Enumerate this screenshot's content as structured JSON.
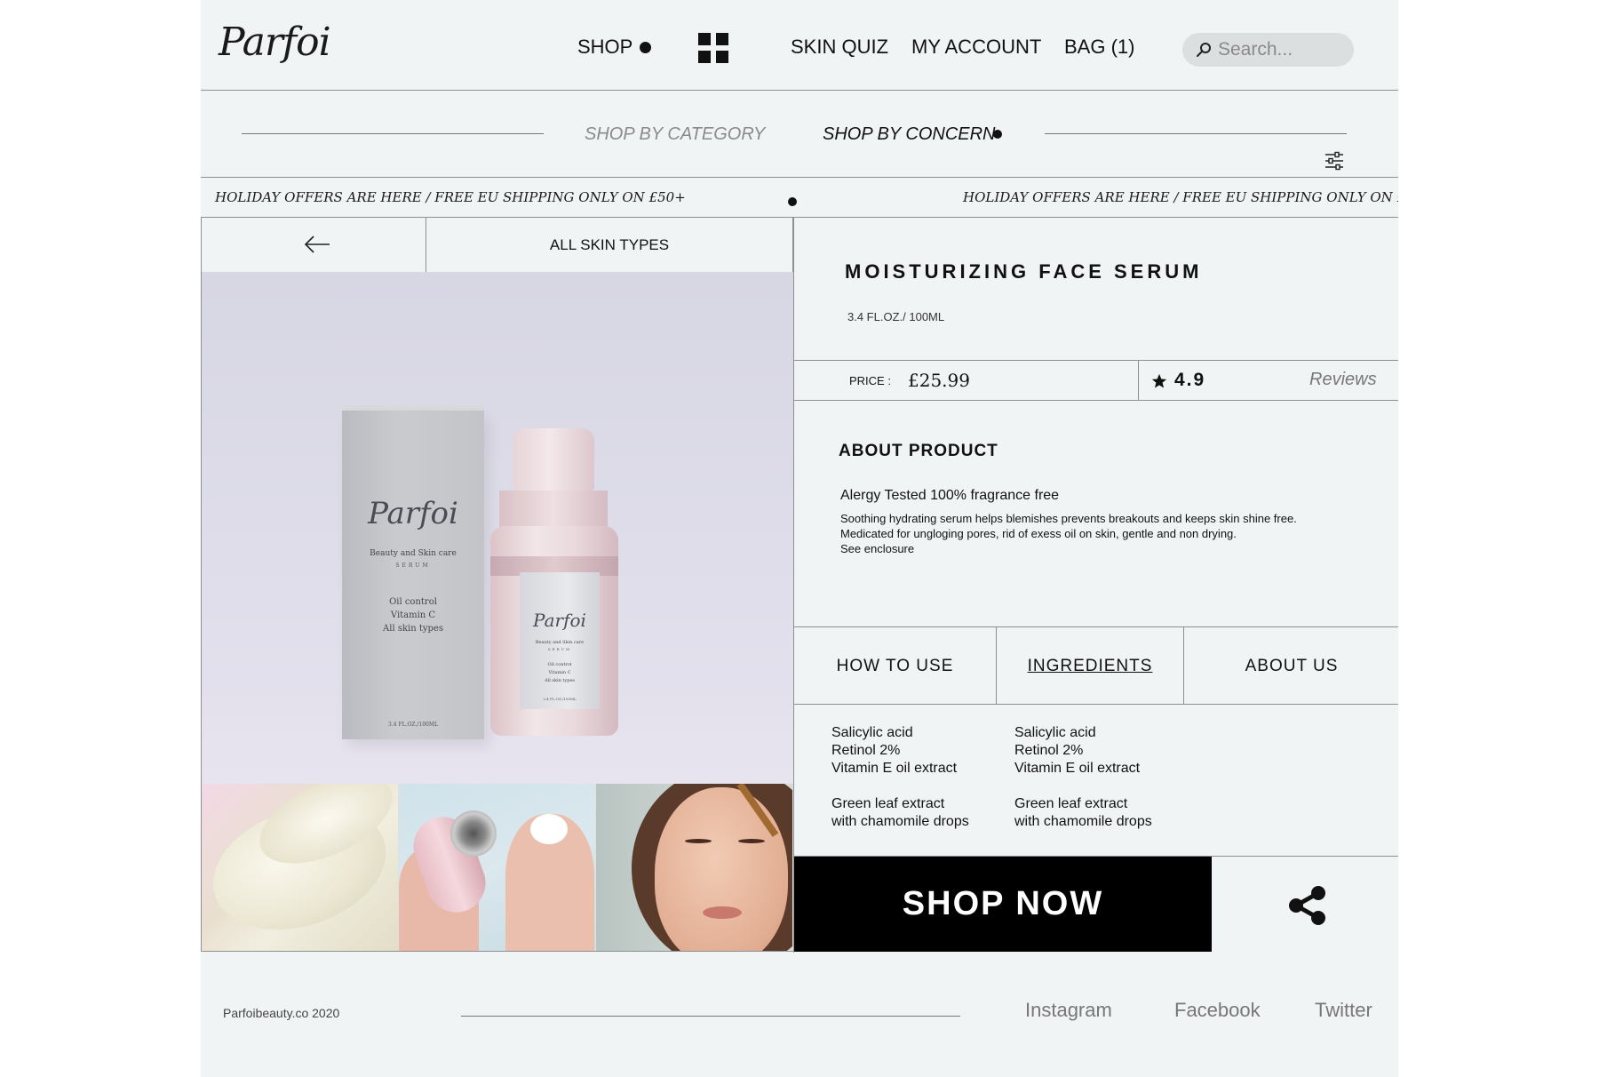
{
  "brand": {
    "logo": "Parfoi"
  },
  "nav": {
    "shop": "SHOP",
    "skin_quiz": "SKIN QUIZ",
    "my_account": "MY ACCOUNT",
    "bag": "BAG (1)"
  },
  "search": {
    "placeholder": "Search..."
  },
  "categories": {
    "by_category": "SHOP BY CATEGORY",
    "by_concern": "SHOP BY CONCERN"
  },
  "promo": {
    "text": "HOLIDAY OFFERS ARE HERE / FREE EU SHIPPING ONLY ON £50+"
  },
  "filter": {
    "skin_types": "ALL SKIN TYPES"
  },
  "product_image": {
    "box_logo": "Parfoi",
    "box_subtitle": "Beauty and Skin care",
    "box_serum": "SERUM",
    "box_info_1": "Oil control",
    "box_info_2": "Vitamin C",
    "box_info_3": "All skin types",
    "box_volume": "3.4 FL.OZ./100ML"
  },
  "product": {
    "title": "MOISTURIZING FACE SERUM",
    "volume": "3.4 FL.OZ./ 100ML",
    "price_label": "PRICE :",
    "price": "£25.99",
    "rating": "4.9",
    "reviews": "Reviews",
    "about_heading": "ABOUT PRODUCT",
    "about_tag": "Alergy Tested 100% fragrance free",
    "about_line_1": "Soothing hydrating serum helps blemishes prevents breakouts and keeps skin shine free.",
    "about_line_2": "Medicated for ungloging pores, rid of exess oil on skin, gentle and non drying.",
    "about_line_3": "See enclosure"
  },
  "tabs": {
    "how_to_use": "HOW TO USE",
    "ingredients": "INGREDIENTS",
    "about_us": "ABOUT US",
    "active": "INGREDIENTS"
  },
  "ingredients": {
    "col1": [
      "Salicylic acid",
      "Retinol 2%",
      "Vitamin E oil extract",
      "Green leaf extract",
      "with chamomile drops"
    ],
    "col2": [
      "Salicylic acid",
      "Retinol 2%",
      "Vitamin E oil extract",
      "Green leaf extract",
      "with chamomile drops"
    ]
  },
  "cta": {
    "shop_now": "SHOP NOW"
  },
  "icons": {
    "search": "search-icon",
    "grid": "grid-icon",
    "filter": "filter-sliders-icon",
    "back": "arrow-left-icon",
    "star": "star-icon",
    "share": "share-icon"
  },
  "footer": {
    "copyright": "Parfoibeauty.co  2020",
    "instagram": "Instagram",
    "facebook": "Facebook",
    "twitter": "Twitter"
  },
  "colors": {
    "page_bg": "#f1f4f5",
    "cta_bg": "#000000",
    "cta_text": "#ffffff",
    "muted_text": "#777777"
  }
}
